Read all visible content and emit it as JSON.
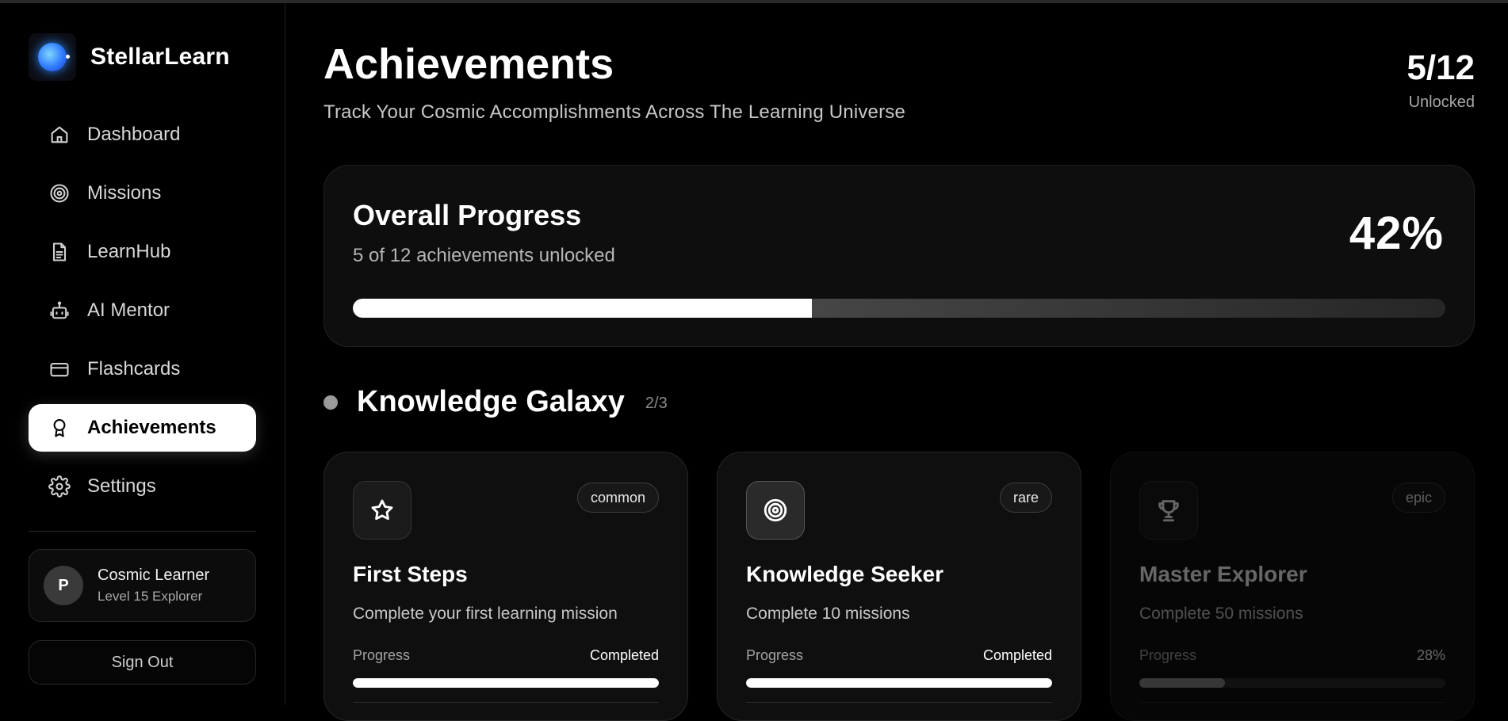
{
  "app": {
    "name": "StellarLearn"
  },
  "sidebar": {
    "items": [
      {
        "label": "Dashboard",
        "icon": "home-icon",
        "active": false
      },
      {
        "label": "Missions",
        "icon": "target-icon",
        "active": false
      },
      {
        "label": "LearnHub",
        "icon": "document-icon",
        "active": false
      },
      {
        "label": "AI Mentor",
        "icon": "robot-icon",
        "active": false
      },
      {
        "label": "Flashcards",
        "icon": "card-icon",
        "active": false
      },
      {
        "label": "Achievements",
        "icon": "award-icon",
        "active": true
      },
      {
        "label": "Settings",
        "icon": "gear-icon",
        "active": false
      }
    ],
    "user": {
      "initial": "P",
      "name": "Cosmic Learner",
      "level": "Level 15 Explorer"
    },
    "sign_out": "Sign Out"
  },
  "header": {
    "title": "Achievements",
    "subtitle": "Track Your Cosmic Accomplishments Across The Learning Universe",
    "unlocked_count": "5/12",
    "unlocked_label": "Unlocked"
  },
  "overall": {
    "title": "Overall Progress",
    "subtitle": "5 of 12 achievements unlocked",
    "percent_text": "42%",
    "percent_value": 0.42
  },
  "section": {
    "title": "Knowledge Galaxy",
    "count": "2/3"
  },
  "cards": [
    {
      "icon": "star-icon",
      "rarity": "common",
      "title": "First Steps",
      "description": "Complete your first learning mission",
      "progress_label": "Progress",
      "progress_text": "Completed",
      "progress_value": 1.0,
      "locked": false
    },
    {
      "icon": "target-icon",
      "rarity": "rare",
      "title": "Knowledge Seeker",
      "description": "Complete 10 missions",
      "progress_label": "Progress",
      "progress_text": "Completed",
      "progress_value": 1.0,
      "locked": false
    },
    {
      "icon": "trophy-icon",
      "rarity": "epic",
      "title": "Master Explorer",
      "description": "Complete 50 missions",
      "progress_label": "Progress",
      "progress_text": "28%",
      "progress_value": 0.28,
      "locked": true
    }
  ]
}
